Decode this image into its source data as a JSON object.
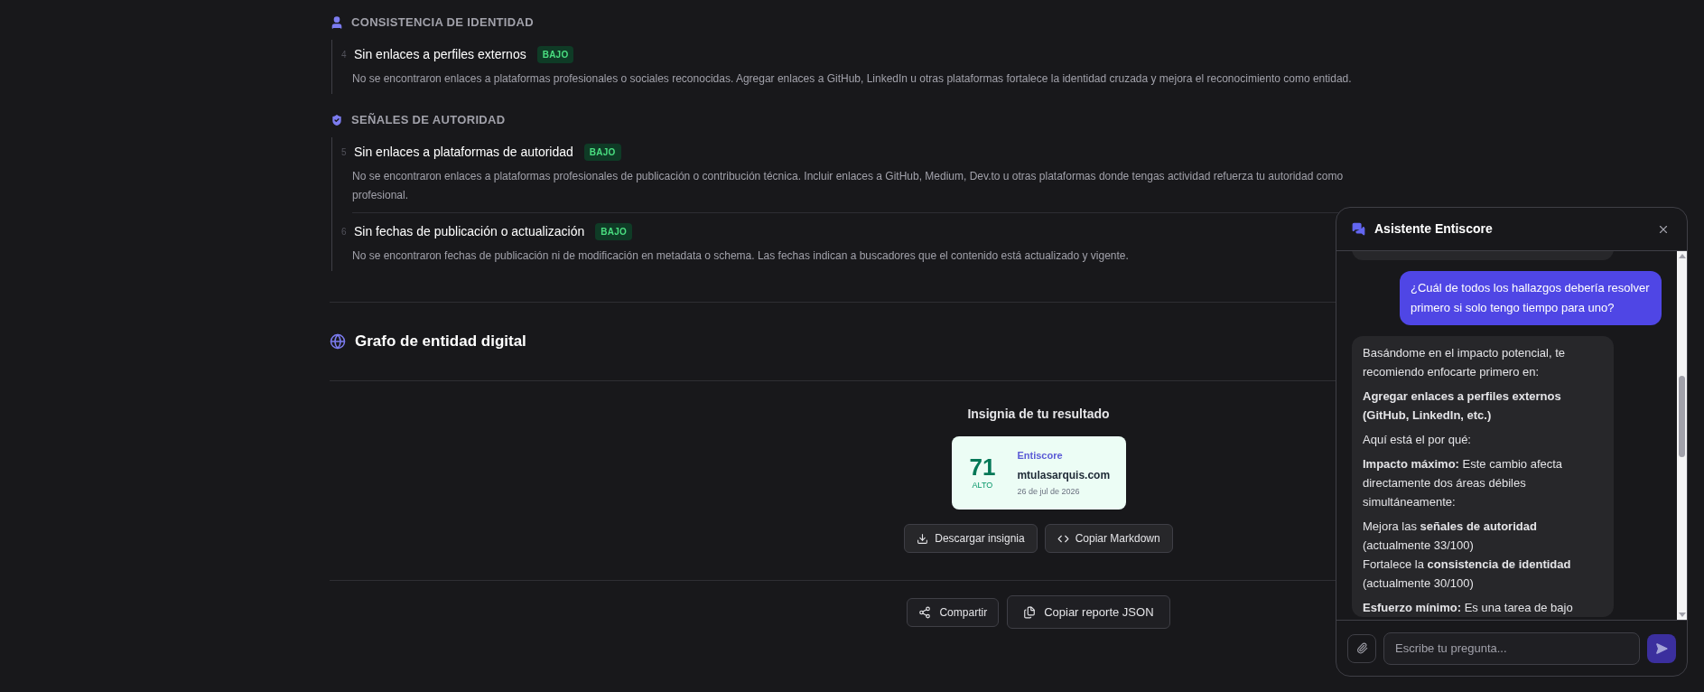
{
  "sections": [
    {
      "kind": "user",
      "title": "CONSISTENCIA DE IDENTIDAD",
      "findings": [
        {
          "number": "4",
          "title": "Sin enlaces a perfiles externos",
          "severity": "BAJO",
          "description": "No se encontraron enlaces a plataformas profesionales o sociales reconocidas. Agregar enlaces a GitHub, LinkedIn u otras plataformas fortalece la identidad cruzada y mejora el reconocimiento como entidad."
        }
      ]
    },
    {
      "kind": "shield",
      "title": "SEÑALES DE AUTORIDAD",
      "findings": [
        {
          "number": "5",
          "title": "Sin enlaces a plataformas de autoridad",
          "severity": "BAJO",
          "description": "No se encontraron enlaces a plataformas profesionales de publicación o contribución técnica. Incluir enlaces a GitHub, Medium, Dev.to u otras plataformas donde tengas actividad refuerza tu autoridad como profesional."
        },
        {
          "number": "6",
          "title": "Sin fechas de publicación o actualización",
          "severity": "BAJO",
          "description": "No se encontraron fechas de publicación ni de modificación en metadata o schema. Las fechas indican a buscadores que el contenido está actualizado y vigente."
        }
      ]
    }
  ],
  "graph": {
    "title": "Grafo de entidad digital"
  },
  "badge": {
    "heading": "Insignia de tu resultado",
    "score": "71",
    "level": "ALTO",
    "brand": "Entiscore",
    "domain": "mtulasarquis.com",
    "date": "26 de jul de 2026"
  },
  "badge_actions": [
    {
      "kind": "download",
      "label": "Descargar insignia"
    },
    {
      "kind": "code",
      "label": "Copiar Markdown"
    }
  ],
  "footer_actions": [
    {
      "kind": "share",
      "label": "Compartir"
    },
    {
      "kind": "copy",
      "label": "Copiar reporte JSON"
    }
  ],
  "chat": {
    "title": "Asistente Entiscore",
    "messages": [
      {
        "kind": "assistant"
      },
      {
        "kind": "user",
        "text": "¿Cuál de todos los hallazgos debería resolver primero si solo tengo tiempo para uno?"
      },
      {
        "kind": "assistant",
        "blocks": [
          {
            "kind": "p",
            "text": "Basándome en el impacto potencial, te recomiendo enfocarte primero en:"
          },
          {
            "kind": "p",
            "text": "**Agregar enlaces a perfiles externos (GitHub, LinkedIn, etc.)**"
          },
          {
            "kind": "p",
            "text": "Aquí está el por qué:"
          },
          {
            "kind": "p",
            "text": "**Impacto máximo:** Este cambio afecta directamente dos áreas débiles simultáneamente:"
          },
          {
            "kind": "list",
            "items": [
              "Mejora las **señales de autoridad** (actualmente 33/100)",
              "Fortalece la **consistencia de identidad** (actualmente 30/100)"
            ]
          },
          {
            "kind": "p",
            "text": "**Esfuerzo mínimo:** Es una tarea de bajo"
          }
        ]
      }
    ],
    "input": {
      "placeholder": "Escribe tu pregunta..."
    }
  }
}
